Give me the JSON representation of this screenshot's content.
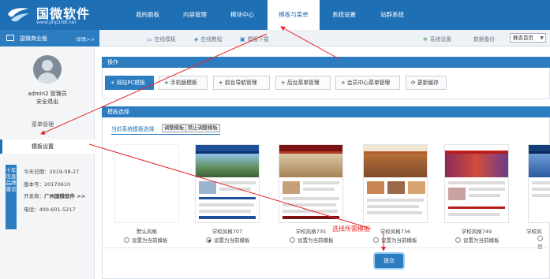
{
  "header": {
    "logo_title": "国微软件",
    "logo_url": "www.php168.net",
    "nav": [
      "我的面板",
      "内容管理",
      "模块中心",
      "模板与菜单",
      "系统设置",
      "站群系统"
    ],
    "active_nav": "模板与菜单"
  },
  "subbar": {
    "edition": "国微商业版",
    "details": "详情>>",
    "links": [
      "在线模板",
      "在线教程",
      "模板下载"
    ],
    "right_links": [
      "系统设置",
      "数据备份"
    ],
    "static_select": "静态首页"
  },
  "sidebar": {
    "username": "admin2 管理员",
    "logout": "安全退出",
    "items": [
      "菜单管理",
      "模板设置"
    ],
    "active_item": "模板设置",
    "badge": "十年信息品牌建设",
    "info": {
      "date": "今天日期：2019-08-27",
      "version": "版本号：20170610",
      "developer_label": "开发商：",
      "developer": "广州国微软件 >>",
      "phone": "电话：400-601-5217"
    }
  },
  "operations": {
    "title": "操作",
    "buttons": [
      "+ 网站PC模板",
      "+ 手机版模板",
      "+ 前台导航管理",
      "+ 后台菜单管理",
      "+ 会员中心菜单管理",
      "更新缓存"
    ]
  },
  "templates": {
    "title": "模板选择",
    "tabs_label": "当前系统模板选择",
    "tabs": [
      "调整模板",
      "禁止调整模板"
    ],
    "items": [
      {
        "name": "默认风格",
        "radio": "设置为当前模板",
        "selected": false
      },
      {
        "name": "学校风格707",
        "radio": "设置为当前模板",
        "selected": true
      },
      {
        "name": "学校风格735",
        "radio": "设置为当前模板",
        "selected": false
      },
      {
        "name": "学校风格736",
        "radio": "设置为当前模板",
        "selected": false
      },
      {
        "name": "学校风格749",
        "radio": "设置为当前模板",
        "selected": false
      },
      {
        "name": "学校风",
        "radio": "设",
        "selected": false
      }
    ],
    "submit": "提交"
  },
  "annotation": "选择所需模板",
  "colors": {
    "brand": "#1f6fb5",
    "accent": "#2c7cc0",
    "annotation": "#e8262a"
  }
}
